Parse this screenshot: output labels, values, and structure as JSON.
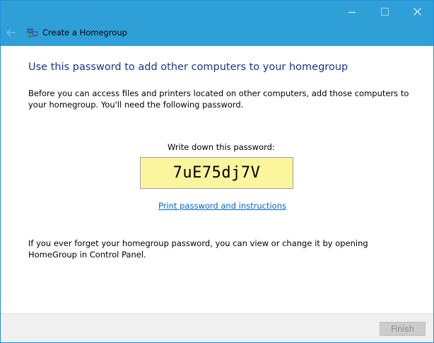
{
  "window": {
    "title": "Create a Homegroup",
    "accent_color": "#2f9fd8"
  },
  "icons": {
    "back": "back-arrow-icon",
    "app": "homegroup-icon",
    "minimize": "minimize-icon",
    "maximize": "maximize-icon",
    "close": "close-icon"
  },
  "main": {
    "heading": "Use this password to add other computers to your homegroup",
    "intro": "Before you can access files and printers located on other computers, add those computers to your homegroup. You'll need the following password.",
    "password_label": "Write down this password:",
    "password": "7uE75dj7V",
    "print_link": "Print password and instructions",
    "footnote": "If you ever forget your homegroup password, you can view or change it by opening HomeGroup in Control Panel."
  },
  "footer": {
    "finish_label": "Finish"
  }
}
